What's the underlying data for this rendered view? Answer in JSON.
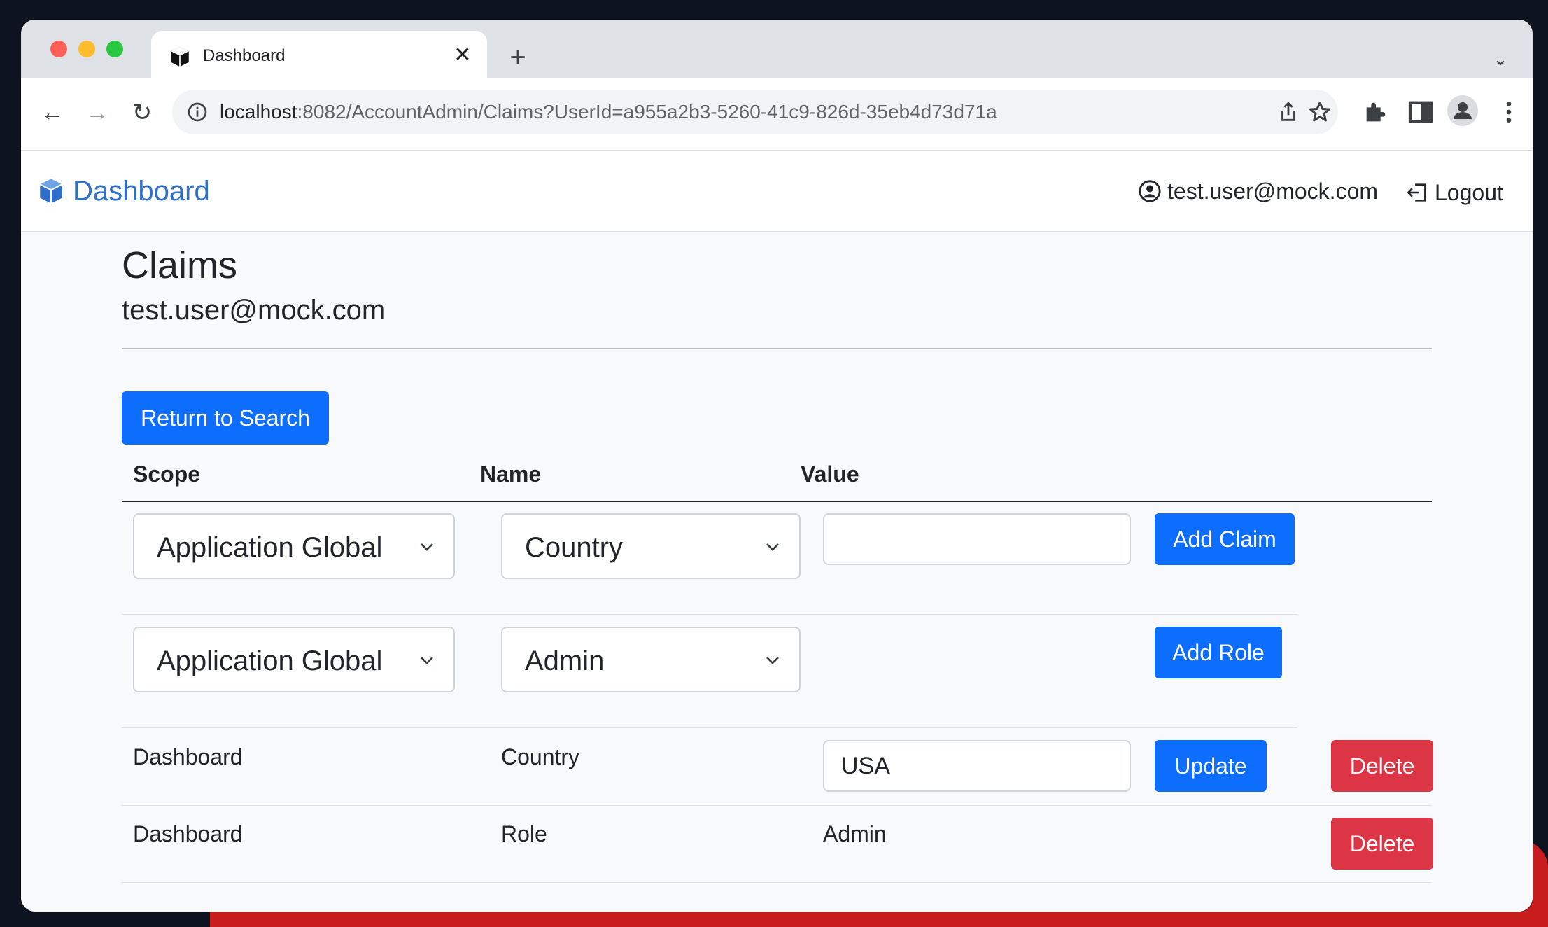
{
  "browser": {
    "tab_title": "Dashboard",
    "url_host": "localhost",
    "url_rest": ":8082/AccountAdmin/Claims?UserId=a955a2b3-5260-41c9-826d-35eb4d73d71a"
  },
  "navbar": {
    "brand": "Dashboard",
    "user": "test.user@mock.com",
    "logout": "Logout"
  },
  "page": {
    "title": "Claims",
    "subtitle": "test.user@mock.com",
    "return_button": "Return to Search"
  },
  "table": {
    "headers": {
      "scope": "Scope",
      "name": "Name",
      "value": "Value"
    },
    "add_claim_row": {
      "scope": "Application Global",
      "name": "Country",
      "value": "",
      "button": "Add Claim"
    },
    "add_role_row": {
      "scope": "Application Global",
      "name": "Admin",
      "button": "Add Role"
    },
    "rows": [
      {
        "scope": "Dashboard",
        "name": "Country",
        "value": "USA",
        "update": "Update",
        "delete": "Delete"
      },
      {
        "scope": "Dashboard",
        "name": "Role",
        "value": "Admin",
        "delete": "Delete"
      }
    ]
  }
}
